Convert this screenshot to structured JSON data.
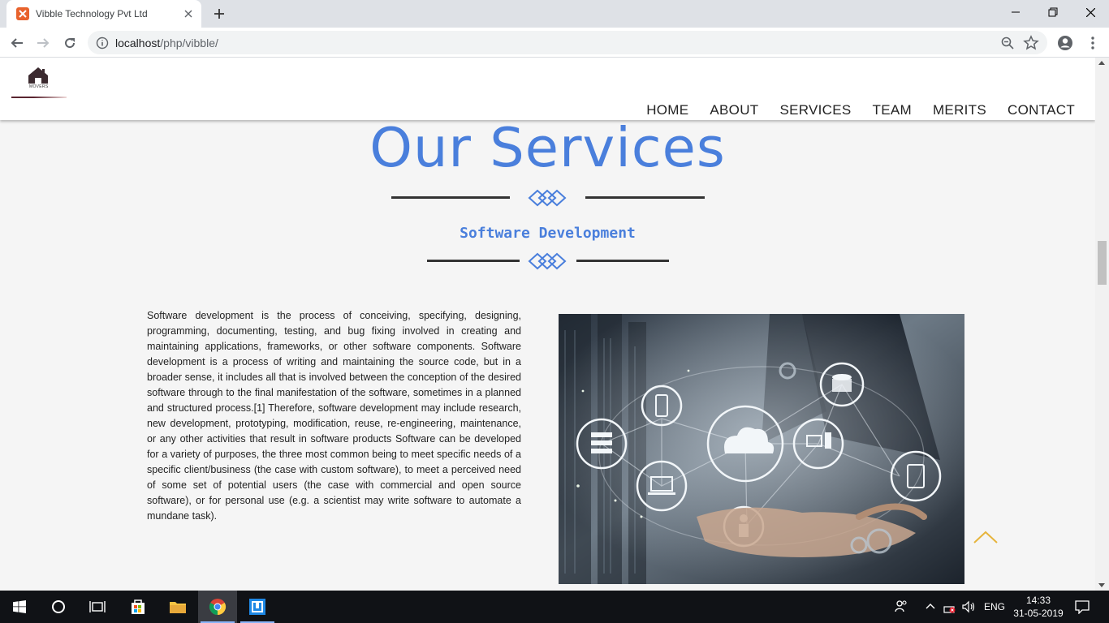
{
  "browser": {
    "tab_title": "Vibble Technology Pvt Ltd",
    "url_host": "localhost",
    "url_path": "/php/vibble/"
  },
  "site": {
    "logo_text": "MOVERS",
    "nav": [
      "HOME",
      "ABOUT",
      "SERVICES",
      "TEAM",
      "MERITS",
      "CONTACT"
    ]
  },
  "services": {
    "heading": "Our Services",
    "subheading": "Software Development",
    "description": "Software development is the process of conceiving, specifying, designing, programming, documenting, testing, and bug fixing involved in creating and maintaining applications, frameworks, or other software components. Software development is a process of writing and maintaining the source code, but in a broader sense, it includes all that is involved between the conception of the desired software through to the final manifestation of the software, sometimes in a planned and structured process.[1] Therefore, software development may include research, new development, prototyping, modification, reuse, re-engineering, maintenance, or any other activities that result in software products Software can be developed for a variety of purposes, the three most common being to meet specific needs of a specific client/business (the case with custom software), to meet a perceived need of some set of potential users (the case with commercial and open source software), or for personal use (e.g. a scientist may write software to automate a mundane task)."
  },
  "taskbar": {
    "language": "ENG",
    "time": "14:33",
    "date": "31-05-2019"
  },
  "colors": {
    "accent": "#4a7fdc",
    "scroll_top_arrow": "#e6b43c",
    "favicon": "#e8622c"
  },
  "icons": [
    "xampp-favicon-icon",
    "tab-close-icon",
    "new-tab-icon",
    "minimize-icon",
    "maximize-icon",
    "window-close-icon",
    "back-icon",
    "forward-icon",
    "reload-icon",
    "info-icon",
    "zoom-icon",
    "star-icon",
    "account-icon",
    "menu-kebab-icon",
    "windows-start-icon",
    "cortana-icon",
    "task-view-icon",
    "store-icon",
    "file-explorer-icon",
    "chrome-icon",
    "app-icon",
    "people-icon",
    "chevron-up-icon",
    "network-icon",
    "volume-icon",
    "notification-icon",
    "scroll-to-top-icon"
  ]
}
